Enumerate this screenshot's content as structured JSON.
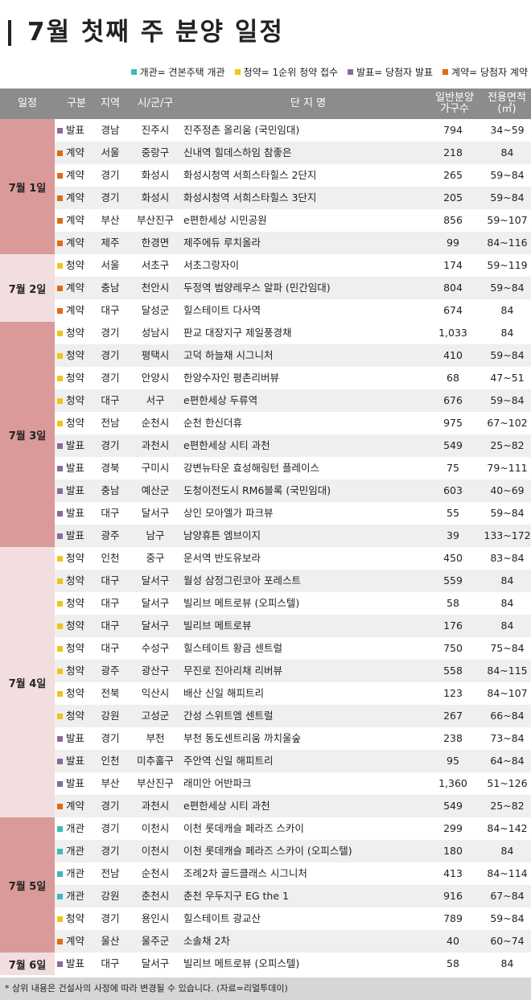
{
  "title": "7월 첫째 주 분양 일정",
  "legend": [
    {
      "label": "개관= 견본주택 개관",
      "color": "#3fb8c0"
    },
    {
      "label": "청약= 1순위 청약 접수",
      "color": "#f0c419"
    },
    {
      "label": "발표= 당첨자 발표",
      "color": "#8a6b99"
    },
    {
      "label": "계약= 당첨자 계약",
      "color": "#e36a14"
    }
  ],
  "type_colors": {
    "개관": "#3fb8c0",
    "청약": "#f0c419",
    "발표": "#8a6b99",
    "계약": "#e36a14"
  },
  "date_colors": {
    "dark": "#db9a9a",
    "light": "#f2dede"
  },
  "header": {
    "date": "일정",
    "type": "구분",
    "region": "지역",
    "city": "시/군/구",
    "name": "단 지 명",
    "units_l1": "일반분양",
    "units_l2": "가구수",
    "area_l1": "전용면적",
    "area_l2": "(㎡)"
  },
  "groups": [
    {
      "date": "7월 1일",
      "shade": "dark",
      "rows": [
        {
          "type": "발표",
          "region": "경남",
          "city": "진주시",
          "name": "진주정촌 올리움 (국민임대)",
          "units": "794",
          "area": "34~59"
        },
        {
          "type": "계약",
          "region": "서울",
          "city": "중랑구",
          "name": "신내역 힐데스하임 참좋은",
          "units": "218",
          "area": "84"
        },
        {
          "type": "계약",
          "region": "경기",
          "city": "화성시",
          "name": "화성시청역 서희스타힐스 2단지",
          "units": "265",
          "area": "59~84"
        },
        {
          "type": "계약",
          "region": "경기",
          "city": "화성시",
          "name": "화성시청역 서희스타힐스 3단지",
          "units": "205",
          "area": "59~84"
        },
        {
          "type": "계약",
          "region": "부산",
          "city": "부산진구",
          "name": "e편한세상 시민공원",
          "units": "856",
          "area": "59~107"
        },
        {
          "type": "계약",
          "region": "제주",
          "city": "한경면",
          "name": "제주에듀 루치올라",
          "units": "99",
          "area": "84~116"
        }
      ]
    },
    {
      "date": "7월 2일",
      "shade": "light",
      "rows": [
        {
          "type": "청약",
          "region": "서울",
          "city": "서초구",
          "name": "서초그랑자이",
          "units": "174",
          "area": "59~119"
        },
        {
          "type": "계약",
          "region": "충남",
          "city": "천안시",
          "name": "두정역 범양레우스 알파 (민간임대)",
          "units": "804",
          "area": "59~84"
        },
        {
          "type": "계약",
          "region": "대구",
          "city": "달성군",
          "name": "힐스테이트 다사역",
          "units": "674",
          "area": "84"
        }
      ]
    },
    {
      "date": "7월 3일",
      "shade": "dark",
      "rows": [
        {
          "type": "청약",
          "region": "경기",
          "city": "성남시",
          "name": "판교 대장지구 제일풍경채",
          "units": "1,033",
          "area": "84"
        },
        {
          "type": "청약",
          "region": "경기",
          "city": "평택시",
          "name": "고덕 하늘채 시그니처",
          "units": "410",
          "area": "59~84"
        },
        {
          "type": "청약",
          "region": "경기",
          "city": "안양시",
          "name": "한양수자인 평촌리버뷰",
          "units": "68",
          "area": "47~51"
        },
        {
          "type": "청약",
          "region": "대구",
          "city": "서구",
          "name": "e편한세상 두류역",
          "units": "676",
          "area": "59~84"
        },
        {
          "type": "청약",
          "region": "전남",
          "city": "순천시",
          "name": "순천 한신더휴",
          "units": "975",
          "area": "67~102"
        },
        {
          "type": "발표",
          "region": "경기",
          "city": "과천시",
          "name": "e편한세상 시티 과천",
          "units": "549",
          "area": "25~82"
        },
        {
          "type": "발표",
          "region": "경북",
          "city": "구미시",
          "name": "강변뉴타운 효성해링턴 플레이스",
          "units": "75",
          "area": "79~111"
        },
        {
          "type": "발표",
          "region": "충남",
          "city": "예산군",
          "name": "도청이전도시 RM6블록 (국민임대)",
          "units": "603",
          "area": "40~69"
        },
        {
          "type": "발표",
          "region": "대구",
          "city": "달서구",
          "name": "상인 모아엘가 파크뷰",
          "units": "55",
          "area": "59~84"
        },
        {
          "type": "발표",
          "region": "광주",
          "city": "남구",
          "name": "남양휴튼 엠브이지",
          "units": "39",
          "area": "133~172"
        }
      ]
    },
    {
      "date": "7월 4일",
      "shade": "light",
      "rows": [
        {
          "type": "청약",
          "region": "인천",
          "city": "중구",
          "name": "운서역 반도유보라",
          "units": "450",
          "area": "83~84"
        },
        {
          "type": "청약",
          "region": "대구",
          "city": "달서구",
          "name": "월성 삼정그린코아 포레스트",
          "units": "559",
          "area": "84"
        },
        {
          "type": "청약",
          "region": "대구",
          "city": "달서구",
          "name": "빌리브 메트로뷰 (오피스텔)",
          "units": "58",
          "area": "84"
        },
        {
          "type": "청약",
          "region": "대구",
          "city": "달서구",
          "name": "빌리브 메트로뷰",
          "units": "176",
          "area": "84"
        },
        {
          "type": "청약",
          "region": "대구",
          "city": "수성구",
          "name": "힐스테이트 황금 센트럴",
          "units": "750",
          "area": "75~84"
        },
        {
          "type": "청약",
          "region": "광주",
          "city": "광산구",
          "name": "무진로 진아리채 리버뷰",
          "units": "558",
          "area": "84~115"
        },
        {
          "type": "청약",
          "region": "전북",
          "city": "익산시",
          "name": "배산 신일 해피트리",
          "units": "123",
          "area": "84~107"
        },
        {
          "type": "청약",
          "region": "강원",
          "city": "고성군",
          "name": "간성 스위트엠 센트럴",
          "units": "267",
          "area": "66~84"
        },
        {
          "type": "발표",
          "region": "경기",
          "city": "부천",
          "name": "부천 동도센트리움 까치울숲",
          "units": "238",
          "area": "73~84"
        },
        {
          "type": "발표",
          "region": "인천",
          "city": "미추홀구",
          "name": "주안역 신일 해피트리",
          "units": "95",
          "area": "64~84"
        },
        {
          "type": "발표",
          "region": "부산",
          "city": "부산진구",
          "name": "래미안 어반파크",
          "units": "1,360",
          "area": "51~126"
        },
        {
          "type": "계약",
          "region": "경기",
          "city": "과천시",
          "name": "e편한세상 시티 과천",
          "units": "549",
          "area": "25~82"
        }
      ]
    },
    {
      "date": "7월 5일",
      "shade": "dark",
      "rows": [
        {
          "type": "개관",
          "region": "경기",
          "city": "이천시",
          "name": "이천 롯데캐슬 페라즈 스카이",
          "units": "299",
          "area": "84~142"
        },
        {
          "type": "개관",
          "region": "경기",
          "city": "이천시",
          "name": "이천 롯데캐슬 페라즈 스카이 (오피스텔)",
          "units": "180",
          "area": "84"
        },
        {
          "type": "개관",
          "region": "전남",
          "city": "순천시",
          "name": "조례2차 골드클래스 시그니처",
          "units": "413",
          "area": "84~114"
        },
        {
          "type": "개관",
          "region": "강원",
          "city": "춘천시",
          "name": "춘천 우두지구 EG the 1",
          "units": "916",
          "area": "67~84"
        },
        {
          "type": "청약",
          "region": "경기",
          "city": "용인시",
          "name": "힐스테이트 광교산",
          "units": "789",
          "area": "59~84"
        },
        {
          "type": "계약",
          "region": "울산",
          "city": "울주군",
          "name": "소솔채 2차",
          "units": "40",
          "area": "60~74"
        }
      ]
    },
    {
      "date": "7월 6일",
      "shade": "light",
      "rows": [
        {
          "type": "발표",
          "region": "대구",
          "city": "달서구",
          "name": "빌리브 메트로뷰 (오피스텔)",
          "units": "58",
          "area": "84"
        }
      ]
    }
  ],
  "footer": "* 상위 내용은 건설사의 사정에 따라 변경될 수 있습니다. (자료=리얼투데이)"
}
